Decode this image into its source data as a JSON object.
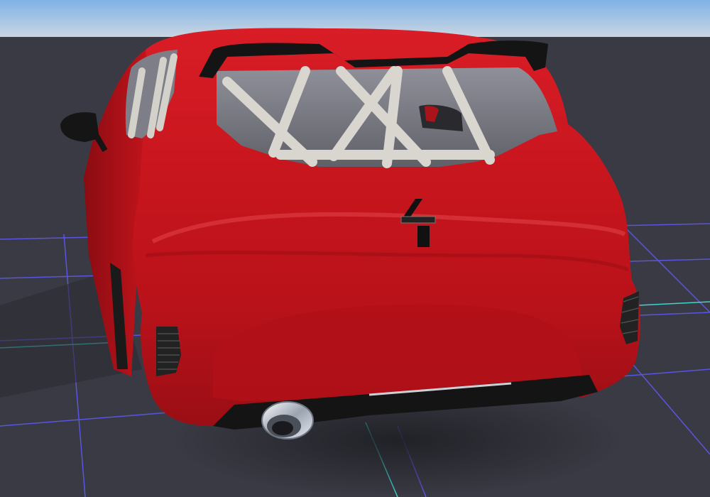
{
  "scene": {
    "subject": "car-rear-view",
    "colors": {
      "sky_top": "#7fb2e6",
      "sky_bottom": "#c9d6e2",
      "ground": "#3a3a44",
      "grid_blue": "#5a55e0",
      "grid_cyan": "#3fd4d0",
      "body_red": "#c8141e",
      "body_dark": "#8a0c12",
      "roll_cage": "#d9d6cf",
      "trim_black": "#141414",
      "chrome": "#dfe3ea"
    }
  }
}
